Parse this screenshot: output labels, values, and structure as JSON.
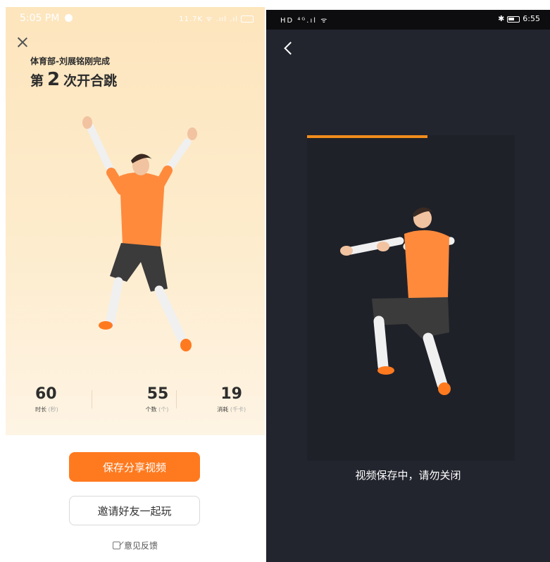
{
  "left_screen": {
    "status_bar": {
      "time": "5:05 PM",
      "indicators": "11.7K ᯤ .ııl .ıl"
    },
    "close_icon": "close-icon",
    "dept_line": "体育部-刘展铭刚完成",
    "title_prefix": "第",
    "count": "2",
    "title_suffix": "次开合跳",
    "stats": [
      {
        "value": "60",
        "label": "时长",
        "unit": "(秒)"
      },
      {
        "value": "55",
        "label": "个数",
        "unit": "(个)"
      },
      {
        "value": "19",
        "label": "消耗",
        "unit": "(千卡)"
      }
    ],
    "primary_button": "保存分享视频",
    "secondary_button": "邀请好友一起玩",
    "feedback_label": "意见反馈",
    "colors": {
      "bg_top": "#fde5bd",
      "accent": "#ff7a1f"
    }
  },
  "right_screen": {
    "status_bar": {
      "left_indicators": "HD ⁴ᴳ.ıl ᯤ",
      "time": "6:55"
    },
    "back_icon": "back-arrow-icon",
    "progress": 0.58,
    "saving_message": "视频保存中，请勿关闭",
    "colors": {
      "bg": "#22242e",
      "progress": "#f28c1c"
    }
  }
}
